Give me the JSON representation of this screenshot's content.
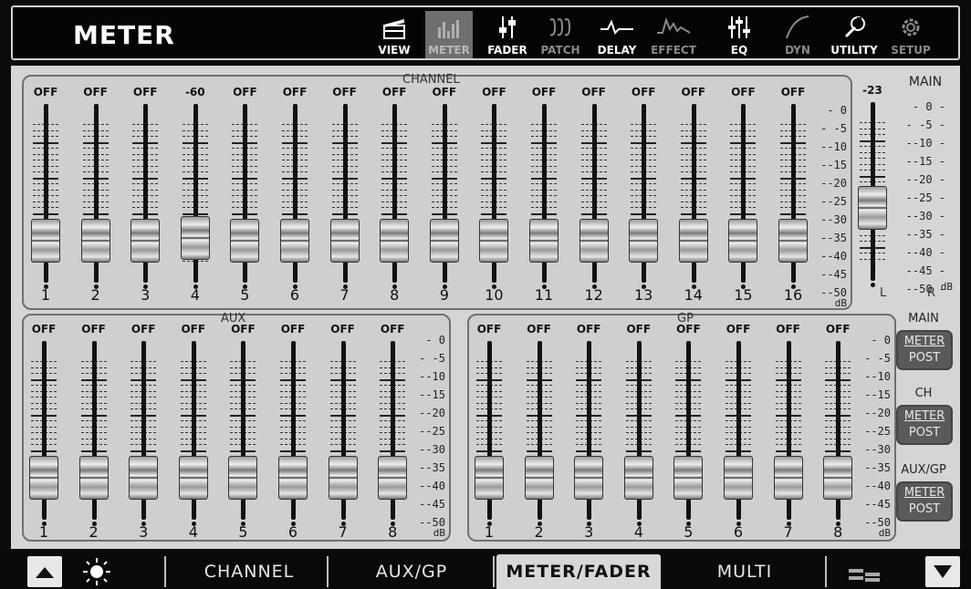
{
  "header": {
    "title": "METER",
    "nav": [
      {
        "label": "VIEW",
        "icon": "clapperboard-icon",
        "state": "normal"
      },
      {
        "label": "METER",
        "icon": "meter-bars-icon",
        "state": "active"
      },
      {
        "label": "FADER",
        "icon": "fader-icon",
        "state": "normal"
      },
      {
        "label": "PATCH",
        "icon": "patch-icon",
        "state": "dim"
      },
      {
        "label": "DELAY",
        "icon": "delay-wave-icon",
        "state": "normal"
      },
      {
        "label": "EFFECT",
        "icon": "effect-wave-icon",
        "state": "dim"
      },
      {
        "label": "EQ",
        "icon": "eq-sliders-icon",
        "state": "normal"
      },
      {
        "label": "DYN",
        "icon": "dyn-curve-icon",
        "state": "dim"
      },
      {
        "label": "UTILITY",
        "icon": "wrench-icon",
        "state": "normal"
      },
      {
        "label": "SETUP",
        "icon": "gear-icon",
        "state": "dim"
      }
    ]
  },
  "channel": {
    "title": "CHANNEL",
    "values": [
      "OFF",
      "OFF",
      "OFF",
      "-60",
      "OFF",
      "OFF",
      "OFF",
      "OFF",
      "OFF",
      "OFF",
      "OFF",
      "OFF",
      "OFF",
      "OFF",
      "OFF",
      "OFF"
    ],
    "numbers": [
      "1",
      "2",
      "3",
      "4",
      "5",
      "6",
      "7",
      "8",
      "9",
      "10",
      "11",
      "12",
      "13",
      "14",
      "15",
      "16"
    ],
    "fader_levels": [
      0.15,
      0.15,
      0.15,
      0.17,
      0.15,
      0.15,
      0.15,
      0.15,
      0.15,
      0.15,
      0.15,
      0.15,
      0.15,
      0.15,
      0.15,
      0.15
    ]
  },
  "main": {
    "title": "MAIN",
    "value": "-23",
    "l_label": "L",
    "r_label": "R",
    "fader_level": 0.38
  },
  "aux": {
    "title": "AUX",
    "values": [
      "OFF",
      "OFF",
      "OFF",
      "OFF",
      "OFF",
      "OFF",
      "OFF",
      "OFF"
    ],
    "numbers": [
      "1",
      "2",
      "3",
      "4",
      "5",
      "6",
      "7",
      "8"
    ],
    "fader_level": 0.15
  },
  "gp": {
    "title": "GP",
    "values": [
      "OFF",
      "OFF",
      "OFF",
      "OFF",
      "OFF",
      "OFF",
      "OFF",
      "OFF"
    ],
    "numbers": [
      "1",
      "2",
      "3",
      "4",
      "5",
      "6",
      "7",
      "8"
    ],
    "fader_level": 0.15
  },
  "db_scale": [
    "- 0",
    "- -5",
    "--10",
    "--15",
    "--20",
    "--25",
    "--30",
    "--35",
    "--40",
    "--45",
    "--50"
  ],
  "db_scale_main": [
    "- 0 -",
    "- -5 -",
    "--10 -",
    "--15 -",
    "--20 -",
    "--25 -",
    "--30 -",
    "--35 -",
    "--40 -",
    "--45 -",
    "--50 -"
  ],
  "db_unit": "dB",
  "meter_post": {
    "groups": [
      {
        "label": "MAIN",
        "top": "METER",
        "bottom": "POST"
      },
      {
        "label": "CH",
        "top": "METER",
        "bottom": "POST"
      },
      {
        "label": "AUX/GP",
        "top": "METER",
        "bottom": "POST"
      }
    ]
  },
  "bottom": {
    "tabs": [
      "CHANNEL",
      "AUX/GP",
      "METER/FADER",
      "MULTI"
    ],
    "selected": "METER/FADER"
  }
}
